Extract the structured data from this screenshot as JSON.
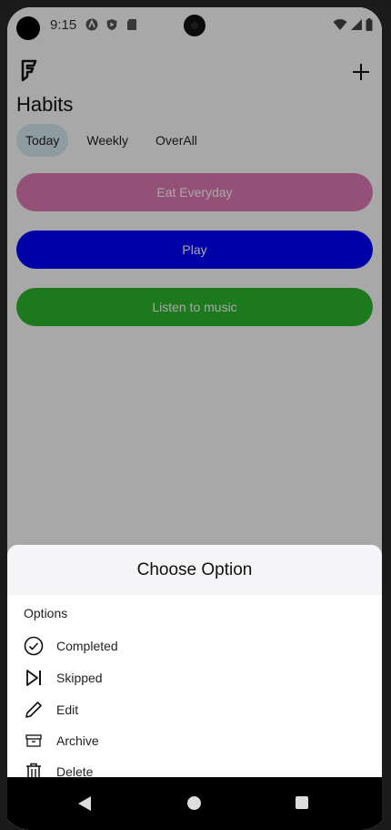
{
  "status_bar": {
    "time": "9:15"
  },
  "app": {
    "title": "Habits",
    "tabs": [
      {
        "label": "Today",
        "active": true
      },
      {
        "label": "Weekly",
        "active": false
      },
      {
        "label": "OverAll",
        "active": false
      }
    ],
    "habits": [
      {
        "label": "Eat Everyday",
        "color": "#e07bb5"
      },
      {
        "label": "Play",
        "color": "#0000ff"
      },
      {
        "label": "Listen to music",
        "color": "#2db82d"
      }
    ]
  },
  "sheet": {
    "title": "Choose Option",
    "section_label": "Options",
    "options": [
      {
        "label": "Completed",
        "icon": "check-circle-icon"
      },
      {
        "label": "Skipped",
        "icon": "skip-next-icon"
      },
      {
        "label": "Edit",
        "icon": "pencil-icon"
      },
      {
        "label": "Archive",
        "icon": "archive-icon"
      },
      {
        "label": "Delete",
        "icon": "trash-icon"
      }
    ]
  },
  "colors": {
    "accent_tab": "#d8edf4",
    "scrim": "rgba(0,0,0,0.34)"
  }
}
